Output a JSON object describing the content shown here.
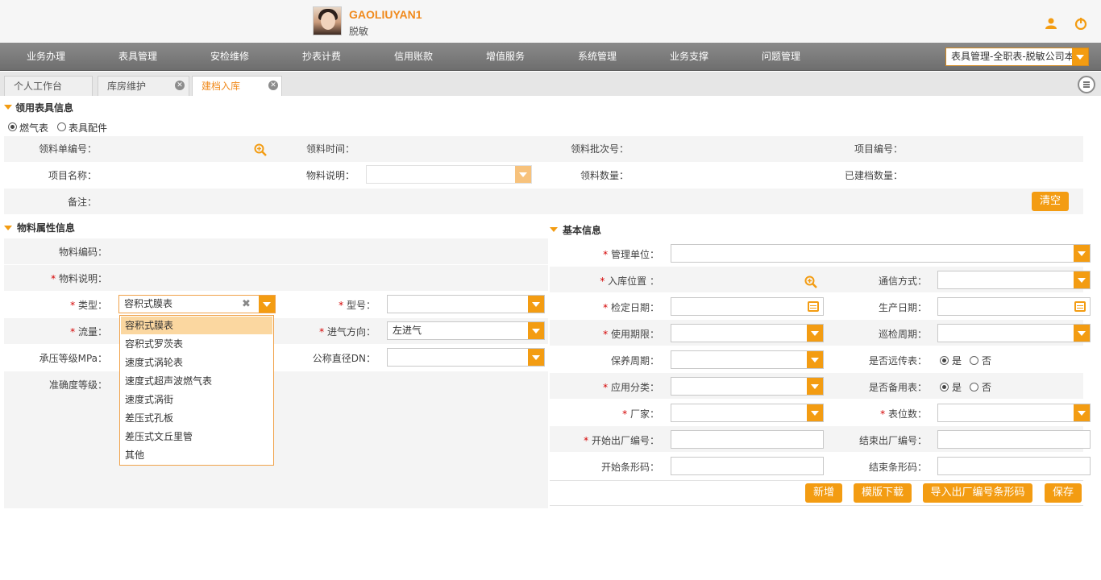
{
  "header": {
    "username": "GAOLIUYAN1",
    "display_name": "脱敏"
  },
  "nav": {
    "items": [
      "业务办理",
      "表具管理",
      "安检维修",
      "抄表计费",
      "信用账款",
      "增值服务",
      "系统管理",
      "业务支撑",
      "问题管理"
    ],
    "role_select": "表具管理-全职表-脱敏公司本"
  },
  "tabs": [
    {
      "label": "个人工作台",
      "active": false
    },
    {
      "label": "库房维护",
      "active": false
    },
    {
      "label": "建档入库",
      "active": true
    }
  ],
  "section_material": {
    "title": "领用表具信息",
    "radio_gas": "燃气表",
    "radio_parts": "表具配件",
    "selected_radio": "燃气表",
    "labels": {
      "order_no": "领料单编号：",
      "time": "领料时间：",
      "batch_no": "领料批次号：",
      "project_no": "项目编号：",
      "project_name": "项目名称：",
      "desc": "物料说明：",
      "qty": "领料数量：",
      "archived_qty": "已建档数量：",
      "remark": "备注："
    },
    "clear_button": "清空"
  },
  "section_attr": {
    "title": "物料属性信息",
    "labels": {
      "code": "物料编码：",
      "desc": "物料说明：",
      "type": "类型：",
      "model": "型号：",
      "flow": "流量：",
      "inlet": "进气方向：",
      "pressure": "承压等级MPa：",
      "diameter": "公称直径DN：",
      "accuracy": "准确度等级："
    },
    "type_value": "容积式膜表",
    "inlet_value": "左进气",
    "type_options": [
      "容积式膜表",
      "容积式罗茨表",
      "速度式涡轮表",
      "速度式超声波燃气表",
      "速度式涡街",
      "差压式孔板",
      "差压式文丘里管",
      "其他"
    ],
    "highlighted_option": "容积式膜表"
  },
  "section_basic": {
    "title": "基本信息",
    "labels": {
      "unit": "管理单位：",
      "location": "入库位置 ：",
      "comm": "通信方式：",
      "check_date": "检定日期：",
      "prod_date": "生产日期：",
      "use_period": "使用期限：",
      "patrol": "巡检周期：",
      "maintain": "保养周期：",
      "remote": "是否远传表：",
      "category": "应用分类：",
      "spare": "是否备用表：",
      "vendor": "厂家：",
      "digits": "表位数：",
      "start_factory": "开始出厂编号：",
      "end_factory": "结束出厂编号：",
      "start_barcode": "开始条形码：",
      "end_barcode": "结束条形码："
    },
    "yes": "是",
    "no": "否",
    "remote_selected": "是",
    "spare_selected": "是",
    "buttons": {
      "add": "新增",
      "template": "模版下载",
      "import": "导入出厂编号条形码",
      "save": "保存"
    }
  },
  "colors": {
    "accent": "#f39c12",
    "nav_bg": "#7a7a7a",
    "required": "#d40000",
    "dropdown_highlight": "#fbd7a0"
  }
}
